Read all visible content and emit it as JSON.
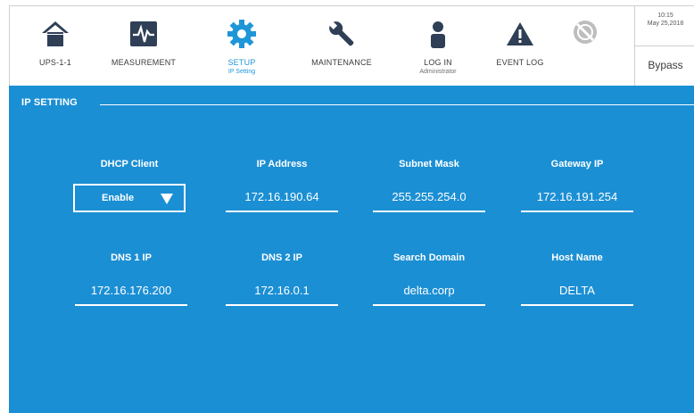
{
  "nav": {
    "items": [
      {
        "label": "UPS-1-1",
        "sub": "",
        "icon": "home-icon"
      },
      {
        "label": "MEASUREMENT",
        "sub": "",
        "icon": "waveform-monitor-icon"
      },
      {
        "label": "SETUP",
        "sub": "IP Setting",
        "icon": "gear-icon"
      },
      {
        "label": "MAINTENANCE",
        "sub": "",
        "icon": "wrench-icon"
      },
      {
        "label": "LOG IN",
        "sub": "Administrator",
        "icon": "user-icon"
      },
      {
        "label": "EVENT LOG",
        "sub": "",
        "icon": "warning-triangle-icon"
      },
      {
        "label": "",
        "sub": "",
        "icon": "disabled-circle-icon"
      }
    ],
    "active_index": 2
  },
  "status": {
    "time": "10:15",
    "date": "May 25,2018",
    "mode": "Bypass"
  },
  "section": {
    "title": "IP SETTING"
  },
  "fields": {
    "dhcp": {
      "label": "DHCP Client",
      "value": "Enable"
    },
    "ip": {
      "label": "IP Address",
      "value": "172.16.190.64"
    },
    "subnet": {
      "label": "Subnet Mask",
      "value": "255.255.254.0"
    },
    "gateway": {
      "label": "Gateway IP",
      "value": "172.16.191.254"
    },
    "dns1": {
      "label": "DNS 1 IP",
      "value": "172.16.176.200"
    },
    "dns2": {
      "label": "DNS 2 IP",
      "value": "172.16.0.1"
    },
    "domain": {
      "label": "Search Domain",
      "value": "delta.corp"
    },
    "host": {
      "label": "Host Name",
      "value": "DELTA"
    }
  },
  "colors": {
    "accent": "#1b8fd4",
    "icon": "#2f3f55",
    "active_icon": "#1f96d8"
  }
}
